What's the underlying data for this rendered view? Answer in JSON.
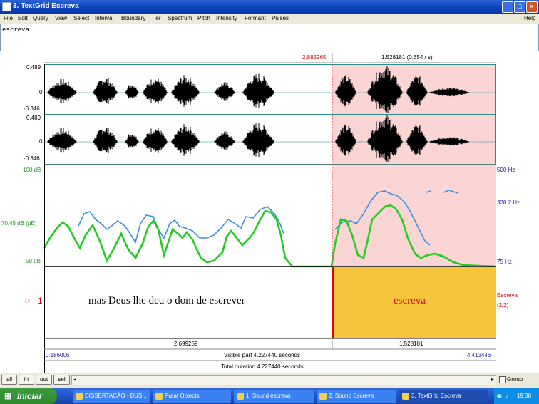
{
  "window": {
    "title": "3. TextGrid Escreva",
    "buttons": [
      "_",
      "□",
      "×"
    ]
  },
  "menu": {
    "items": [
      "File",
      "Edit",
      "Query",
      "View",
      "Select",
      "Interval",
      "Boundary",
      "Tier",
      "Spectrum",
      "Pitch",
      "Intensity",
      "Formant",
      "Pulses"
    ],
    "help": "Help"
  },
  "text_field": {
    "value": "escreva"
  },
  "time_bar": {
    "cursor": "2.885265",
    "selection": "1.528181 (0.654 / s)"
  },
  "waveform1": {
    "max": "0.489",
    "zero": "0",
    "min": "-0.346"
  },
  "waveform2": {
    "max": "0.489",
    "zero": "0",
    "min": "-0.346"
  },
  "analysis": {
    "intensity_top": "100 dB",
    "intensity_mid": "70.45 dB (μE)",
    "intensity_bottom": "50 dB",
    "pitch_top": "500 Hz",
    "pitch_mid": "338.2 Hz",
    "pitch_bottom": "75 Hz"
  },
  "tier": {
    "number": "1",
    "interval1": "mas Deus lhe deu o dom de escrever",
    "interval2": "escreva",
    "name": "Escreva",
    "count": "(2/2)"
  },
  "duration_bar": {
    "left": "2.699259",
    "right": "1.528181"
  },
  "visible_bar": {
    "start": "0.186006",
    "label": "Visible part 4.227440 seconds",
    "end": "4.413446"
  },
  "total_bar": {
    "label": "Total duration 4.227440 seconds"
  },
  "bottom_buttons": {
    "all": "all",
    "in": "in",
    "out": "out",
    "sel": "sel",
    "group": "Group"
  },
  "taskbar": {
    "start": "Iniciar",
    "tasks": [
      "DISSERTAÇÃO - BUS...",
      "Praat Objects",
      "1. Sound escreva",
      "2. Sound Escreva",
      "3. TextGrid Escreva"
    ],
    "clock": "19:38"
  },
  "colors": {
    "selection": "#fbd4d4",
    "interval_selected": "#f6c53c",
    "intensity": "#22cc22",
    "pitch": "#3a8fe0",
    "red": "#e00000",
    "blue": "#1a1aa0"
  }
}
